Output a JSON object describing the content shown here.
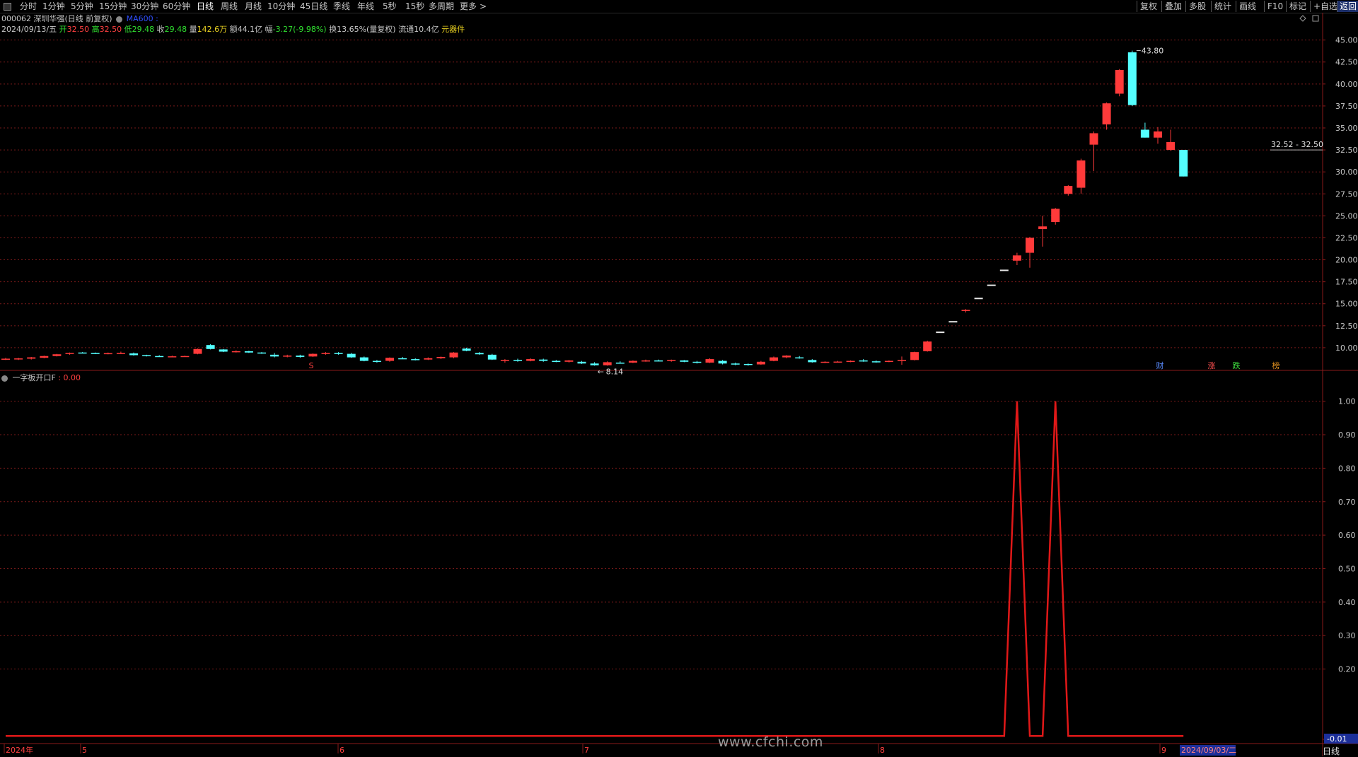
{
  "toolbar": {
    "menu_icon": "panel-toggle-icon",
    "periods": [
      "分时",
      "1分钟",
      "5分钟",
      "15分钟",
      "30分钟",
      "60分钟",
      "日线",
      "周线",
      "月线",
      "10分钟",
      "45日线",
      "季线",
      "年线",
      "5秒",
      "15秒",
      "多周期",
      "更多"
    ],
    "active_period": "日线",
    "more_arrow": ">",
    "right_buttons": [
      "复权",
      "叠加",
      "多股",
      "统计",
      "画线",
      "F10",
      "标记",
      "+自选",
      "返回"
    ]
  },
  "stock": {
    "code_name": "000062 深圳华强(日线 前复权)",
    "indicator_icon": "settings-circle-icon",
    "ma_label": "MA600 :"
  },
  "quote": {
    "date": "2024/09/13/五",
    "open_label": "开",
    "open": "32.50",
    "high_label": "高",
    "high": "32.50",
    "low_label": "低",
    "low": "29.48",
    "close_label": "收",
    "close": "29.48",
    "vol_label": "量",
    "vol": "142.6万",
    "amt_label": "额",
    "amt": "44.1亿",
    "chg_label": "幅",
    "chg": "-3.27(-9.98%)",
    "turnover": "换13.65%(量复权)",
    "float": "流通10.4亿",
    "sector": "元器件"
  },
  "price_axis": [
    "45.00",
    "42.50",
    "40.00",
    "37.50",
    "35.00",
    "32.50",
    "30.00",
    "27.50",
    "25.00",
    "22.50",
    "20.00",
    "17.50",
    "15.00",
    "12.50",
    "10.00"
  ],
  "annotations": {
    "high": "43.80",
    "low": "8.14",
    "cursor_price": "32.52 - 32.50",
    "low_arrow": "←"
  },
  "event_markers": {
    "s": "S",
    "cai": "财",
    "zhang": "涨",
    "die": "跌",
    "bang": "榜"
  },
  "indicator": {
    "name": "一字板开口F",
    "value": ": 0.00",
    "axis": [
      "1.00",
      "0.90",
      "0.80",
      "0.70",
      "0.60",
      "0.50",
      "0.40",
      "0.30",
      "0.20",
      "-0.01"
    ]
  },
  "time_axis": [
    "2024年",
    "5",
    "6",
    "7",
    "8",
    "9"
  ],
  "time_cursor": "2024/09/03/二",
  "period_label": "日线",
  "watermark": "www.cfchi.com",
  "colors": {
    "up": "#ff3a3a",
    "down": "#54ffff",
    "grid": "#7a1a1a",
    "indicator_line": "#e01818",
    "axis_text": "#c8c8c8"
  },
  "chart_data": {
    "type": "candlestick",
    "price_range": [
      7.5,
      46.5
    ],
    "candles": [
      {
        "o": 8.7,
        "h": 8.85,
        "l": 8.6,
        "c": 8.75
      },
      {
        "o": 8.7,
        "h": 8.85,
        "l": 8.6,
        "c": 8.78
      },
      {
        "o": 8.75,
        "h": 8.95,
        "l": 8.65,
        "c": 8.9
      },
      {
        "o": 8.85,
        "h": 9.1,
        "l": 8.8,
        "c": 9.05
      },
      {
        "o": 9.05,
        "h": 9.3,
        "l": 9.0,
        "c": 9.25
      },
      {
        "o": 9.3,
        "h": 9.45,
        "l": 9.2,
        "c": 9.4
      },
      {
        "o": 9.45,
        "h": 9.5,
        "l": 9.35,
        "c": 9.42
      },
      {
        "o": 9.4,
        "h": 9.45,
        "l": 9.3,
        "c": 9.35
      },
      {
        "o": 9.3,
        "h": 9.45,
        "l": 9.25,
        "c": 9.38
      },
      {
        "o": 9.35,
        "h": 9.55,
        "l": 9.3,
        "c": 9.4
      },
      {
        "o": 9.35,
        "h": 9.45,
        "l": 9.1,
        "c": 9.15
      },
      {
        "o": 9.15,
        "h": 9.2,
        "l": 9.0,
        "c": 9.05
      },
      {
        "o": 9.05,
        "h": 9.15,
        "l": 8.95,
        "c": 9.0
      },
      {
        "o": 9.0,
        "h": 9.1,
        "l": 8.95,
        "c": 9.02
      },
      {
        "o": 9.0,
        "h": 9.1,
        "l": 8.95,
        "c": 9.05
      },
      {
        "o": 9.3,
        "h": 9.9,
        "l": 9.25,
        "c": 9.85
      },
      {
        "o": 10.3,
        "h": 10.4,
        "l": 9.8,
        "c": 9.85
      },
      {
        "o": 9.8,
        "h": 9.85,
        "l": 9.5,
        "c": 9.55
      },
      {
        "o": 9.5,
        "h": 9.7,
        "l": 9.45,
        "c": 9.6
      },
      {
        "o": 9.6,
        "h": 9.65,
        "l": 9.4,
        "c": 9.45
      },
      {
        "o": 9.45,
        "h": 9.5,
        "l": 9.3,
        "c": 9.35
      },
      {
        "o": 9.2,
        "h": 9.4,
        "l": 8.9,
        "c": 9.0
      },
      {
        "o": 9.0,
        "h": 9.2,
        "l": 8.9,
        "c": 9.1
      },
      {
        "o": 9.1,
        "h": 9.2,
        "l": 8.85,
        "c": 8.95
      },
      {
        "o": 9.0,
        "h": 9.35,
        "l": 8.95,
        "c": 9.3
      },
      {
        "o": 9.3,
        "h": 9.5,
        "l": 9.2,
        "c": 9.4
      },
      {
        "o": 9.4,
        "h": 9.5,
        "l": 9.2,
        "c": 9.3
      },
      {
        "o": 9.3,
        "h": 9.4,
        "l": 8.85,
        "c": 8.9
      },
      {
        "o": 8.9,
        "h": 9.0,
        "l": 8.45,
        "c": 8.5
      },
      {
        "o": 8.5,
        "h": 8.6,
        "l": 8.3,
        "c": 8.45
      },
      {
        "o": 8.5,
        "h": 8.9,
        "l": 8.4,
        "c": 8.85
      },
      {
        "o": 8.8,
        "h": 8.95,
        "l": 8.7,
        "c": 8.75
      },
      {
        "o": 8.7,
        "h": 8.8,
        "l": 8.55,
        "c": 8.65
      },
      {
        "o": 8.65,
        "h": 8.9,
        "l": 8.6,
        "c": 8.8
      },
      {
        "o": 8.8,
        "h": 9.0,
        "l": 8.7,
        "c": 8.95
      },
      {
        "o": 8.9,
        "h": 9.5,
        "l": 8.8,
        "c": 9.45
      },
      {
        "o": 9.9,
        "h": 10.0,
        "l": 9.6,
        "c": 9.65
      },
      {
        "o": 9.4,
        "h": 9.5,
        "l": 9.2,
        "c": 9.25
      },
      {
        "o": 9.2,
        "h": 9.3,
        "l": 8.6,
        "c": 8.65
      },
      {
        "o": 8.5,
        "h": 8.7,
        "l": 8.3,
        "c": 8.6
      },
      {
        "o": 8.6,
        "h": 8.75,
        "l": 8.4,
        "c": 8.5
      },
      {
        "o": 8.5,
        "h": 8.8,
        "l": 8.45,
        "c": 8.7
      },
      {
        "o": 8.65,
        "h": 8.75,
        "l": 8.4,
        "c": 8.5
      },
      {
        "o": 8.5,
        "h": 8.6,
        "l": 8.35,
        "c": 8.45
      },
      {
        "o": 8.4,
        "h": 8.6,
        "l": 8.3,
        "c": 8.55
      },
      {
        "o": 8.4,
        "h": 8.5,
        "l": 8.15,
        "c": 8.2
      },
      {
        "o": 8.2,
        "h": 8.35,
        "l": 7.95,
        "c": 8.0
      },
      {
        "o": 8.0,
        "h": 8.45,
        "l": 7.95,
        "c": 8.35
      },
      {
        "o": 8.3,
        "h": 8.45,
        "l": 8.2,
        "c": 8.25
      },
      {
        "o": 8.3,
        "h": 8.55,
        "l": 8.25,
        "c": 8.5
      },
      {
        "o": 8.5,
        "h": 8.65,
        "l": 8.4,
        "c": 8.55
      },
      {
        "o": 8.55,
        "h": 8.65,
        "l": 8.45,
        "c": 8.5
      },
      {
        "o": 8.5,
        "h": 8.65,
        "l": 8.4,
        "c": 8.6
      },
      {
        "o": 8.55,
        "h": 8.6,
        "l": 8.35,
        "c": 8.4
      },
      {
        "o": 8.4,
        "h": 8.5,
        "l": 8.2,
        "c": 8.3
      },
      {
        "o": 8.3,
        "h": 8.8,
        "l": 8.25,
        "c": 8.7
      },
      {
        "o": 8.5,
        "h": 8.6,
        "l": 8.1,
        "c": 8.2
      },
      {
        "o": 8.2,
        "h": 8.3,
        "l": 8.0,
        "c": 8.15
      },
      {
        "o": 8.15,
        "h": 8.2,
        "l": 7.95,
        "c": 8.05
      },
      {
        "o": 8.1,
        "h": 8.5,
        "l": 8.05,
        "c": 8.4
      },
      {
        "o": 8.5,
        "h": 9.0,
        "l": 8.45,
        "c": 8.9
      },
      {
        "o": 8.9,
        "h": 9.15,
        "l": 8.8,
        "c": 9.1
      },
      {
        "o": 8.9,
        "h": 9.05,
        "l": 8.75,
        "c": 8.8
      },
      {
        "o": 8.6,
        "h": 8.7,
        "l": 8.3,
        "c": 8.35
      },
      {
        "o": 8.35,
        "h": 8.45,
        "l": 8.25,
        "c": 8.4
      },
      {
        "o": 8.4,
        "h": 8.5,
        "l": 8.3,
        "c": 8.42
      },
      {
        "o": 8.42,
        "h": 8.55,
        "l": 8.35,
        "c": 8.5
      },
      {
        "o": 8.55,
        "h": 8.7,
        "l": 8.4,
        "c": 8.5
      },
      {
        "o": 8.45,
        "h": 8.55,
        "l": 8.3,
        "c": 8.4
      },
      {
        "o": 8.45,
        "h": 8.55,
        "l": 8.35,
        "c": 8.5
      },
      {
        "o": 8.6,
        "h": 9.0,
        "l": 8.05,
        "c": 8.6
      },
      {
        "o": 8.6,
        "h": 9.55,
        "l": 8.55,
        "c": 9.5
      },
      {
        "o": 9.6,
        "h": 10.8,
        "l": 9.55,
        "c": 10.7
      },
      {
        "o": 11.75,
        "h": 11.75,
        "l": 11.75,
        "c": 11.75
      },
      {
        "o": 12.95,
        "h": 12.95,
        "l": 12.95,
        "c": 12.95
      },
      {
        "o": 14.2,
        "h": 14.4,
        "l": 14.0,
        "c": 14.3
      },
      {
        "o": 15.6,
        "h": 15.6,
        "l": 15.6,
        "c": 15.6
      },
      {
        "o": 17.1,
        "h": 17.1,
        "l": 17.1,
        "c": 17.1
      },
      {
        "o": 18.8,
        "h": 18.8,
        "l": 18.8,
        "c": 18.8
      },
      {
        "o": 19.9,
        "h": 20.8,
        "l": 19.4,
        "c": 20.5
      },
      {
        "o": 20.8,
        "h": 22.6,
        "l": 19.1,
        "c": 22.5
      },
      {
        "o": 23.5,
        "h": 25.0,
        "l": 21.5,
        "c": 23.8
      },
      {
        "o": 24.3,
        "h": 25.9,
        "l": 24.0,
        "c": 25.8
      },
      {
        "o": 27.5,
        "h": 28.5,
        "l": 27.3,
        "c": 28.4
      },
      {
        "o": 28.2,
        "h": 31.5,
        "l": 27.5,
        "c": 31.3
      },
      {
        "o": 33.1,
        "h": 34.6,
        "l": 30.1,
        "c": 34.4
      },
      {
        "o": 35.4,
        "h": 37.9,
        "l": 34.8,
        "c": 37.8
      },
      {
        "o": 38.9,
        "h": 41.7,
        "l": 38.6,
        "c": 41.6
      },
      {
        "o": 43.6,
        "h": 43.8,
        "l": 37.5,
        "c": 37.6
      },
      {
        "o": 34.8,
        "h": 35.6,
        "l": 33.9,
        "c": 33.9
      },
      {
        "o": 33.9,
        "h": 35.1,
        "l": 33.2,
        "c": 34.6
      },
      {
        "o": 32.5,
        "h": 34.8,
        "l": 32.4,
        "c": 33.4
      },
      {
        "o": 32.5,
        "h": 32.5,
        "l": 29.48,
        "c": 29.48
      }
    ],
    "indicator_series": {
      "name": "一字板开口F",
      "spikes_at_index": [
        79,
        82
      ],
      "value_range": [
        -0.01,
        1.05
      ]
    }
  }
}
